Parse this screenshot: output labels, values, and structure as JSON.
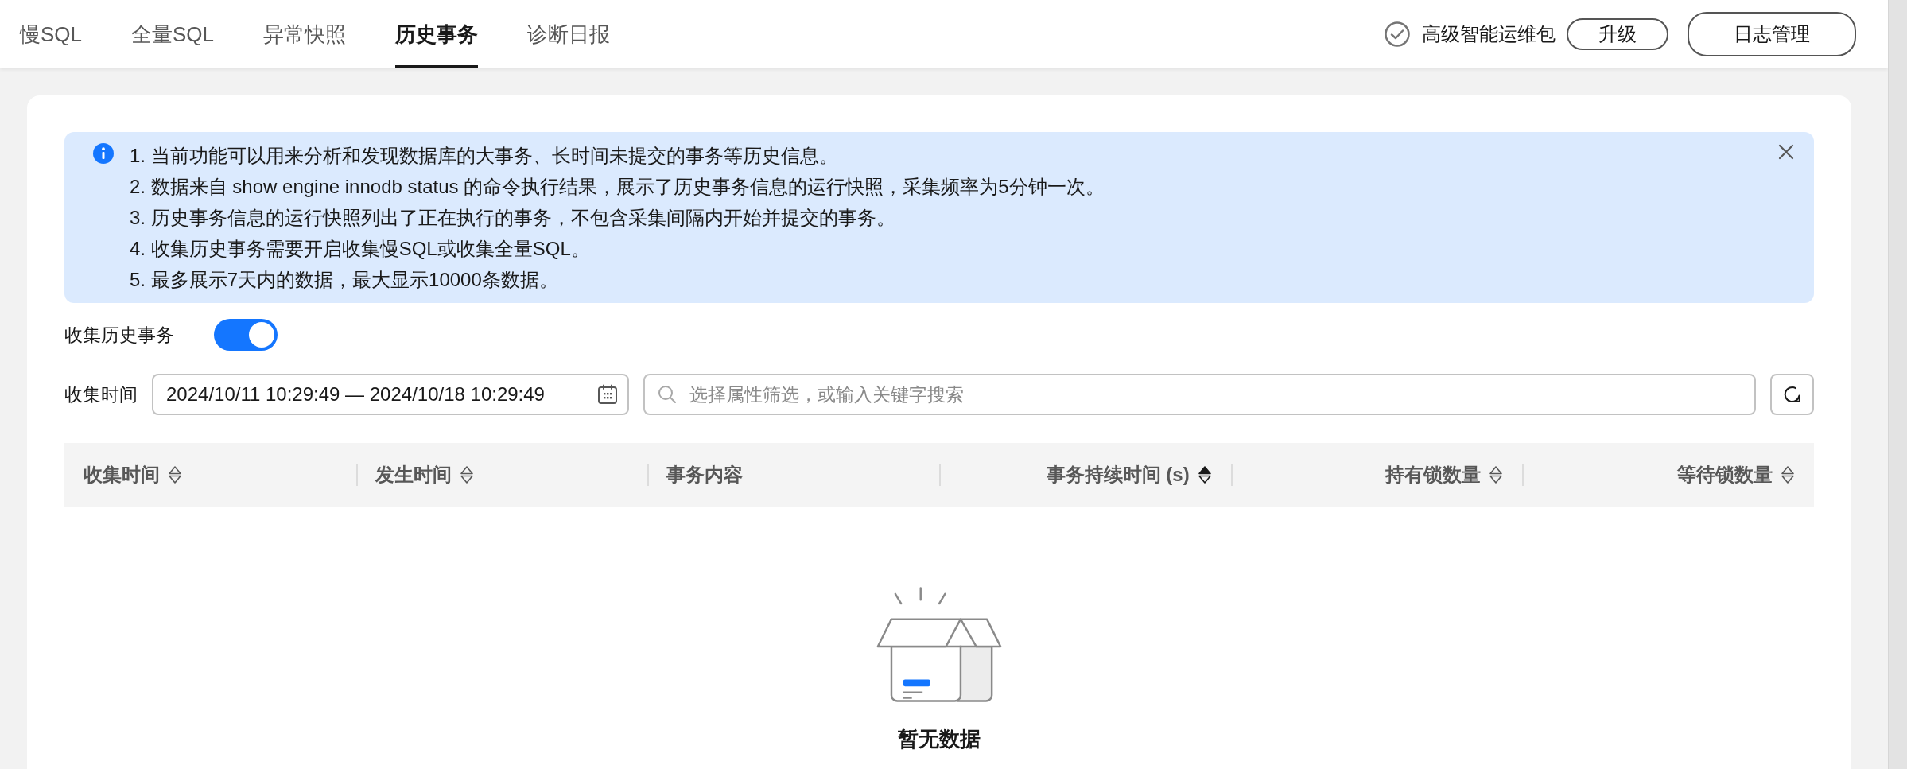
{
  "tabs": [
    {
      "label": "慢SQL",
      "selected": false
    },
    {
      "label": "全量SQL",
      "selected": false
    },
    {
      "label": "异常快照",
      "selected": false
    },
    {
      "label": "历史事务",
      "selected": true
    },
    {
      "label": "诊断日报",
      "selected": false
    }
  ],
  "header_actions": {
    "package_label": "高级智能运维包",
    "package_active": true,
    "upgrade_button": "升级",
    "log_button": "日志管理"
  },
  "notice": {
    "lines": [
      "1. 当前功能可以用来分析和发现数据库的大事务、长时间未提交的事务等历史信息。",
      "2. 数据来自 show engine innodb status 的命令执行结果，展示了历史事务信息的运行快照，采集频率为5分钟一次。",
      "3. 历史事务信息的运行快照列出了正在执行的事务，不包含采集间隔内开始并提交的事务。",
      "4. 收集历史事务需要开启收集慢SQL或收集全量SQL。",
      "5. 最多展示7天内的数据，最大显示10000条数据。"
    ]
  },
  "collect_toggle": {
    "label": "收集历史事务",
    "on": true
  },
  "filter": {
    "label": "收集时间",
    "date_range": "2024/10/11 10:29:49 — 2024/10/18 10:29:49",
    "search_placeholder": "选择属性筛选，或输入关键字搜索"
  },
  "table": {
    "columns": [
      {
        "label": "收集时间",
        "right_aligned": false,
        "sortable": true,
        "sorted_ascending": false
      },
      {
        "label": "发生时间",
        "right_aligned": false,
        "sortable": true,
        "sorted_ascending": false
      },
      {
        "label": "事务内容",
        "right_aligned": false,
        "sortable": false
      },
      {
        "label": "事务持续时间 (s)",
        "right_aligned": true,
        "sortable": true,
        "sorted_ascending": true
      },
      {
        "label": "持有锁数量",
        "right_aligned": true,
        "sortable": true,
        "sorted_ascending": false
      },
      {
        "label": "等待锁数量",
        "right_aligned": true,
        "sortable": true,
        "sorted_ascending": false
      }
    ],
    "empty_text": "暂无数据"
  }
}
